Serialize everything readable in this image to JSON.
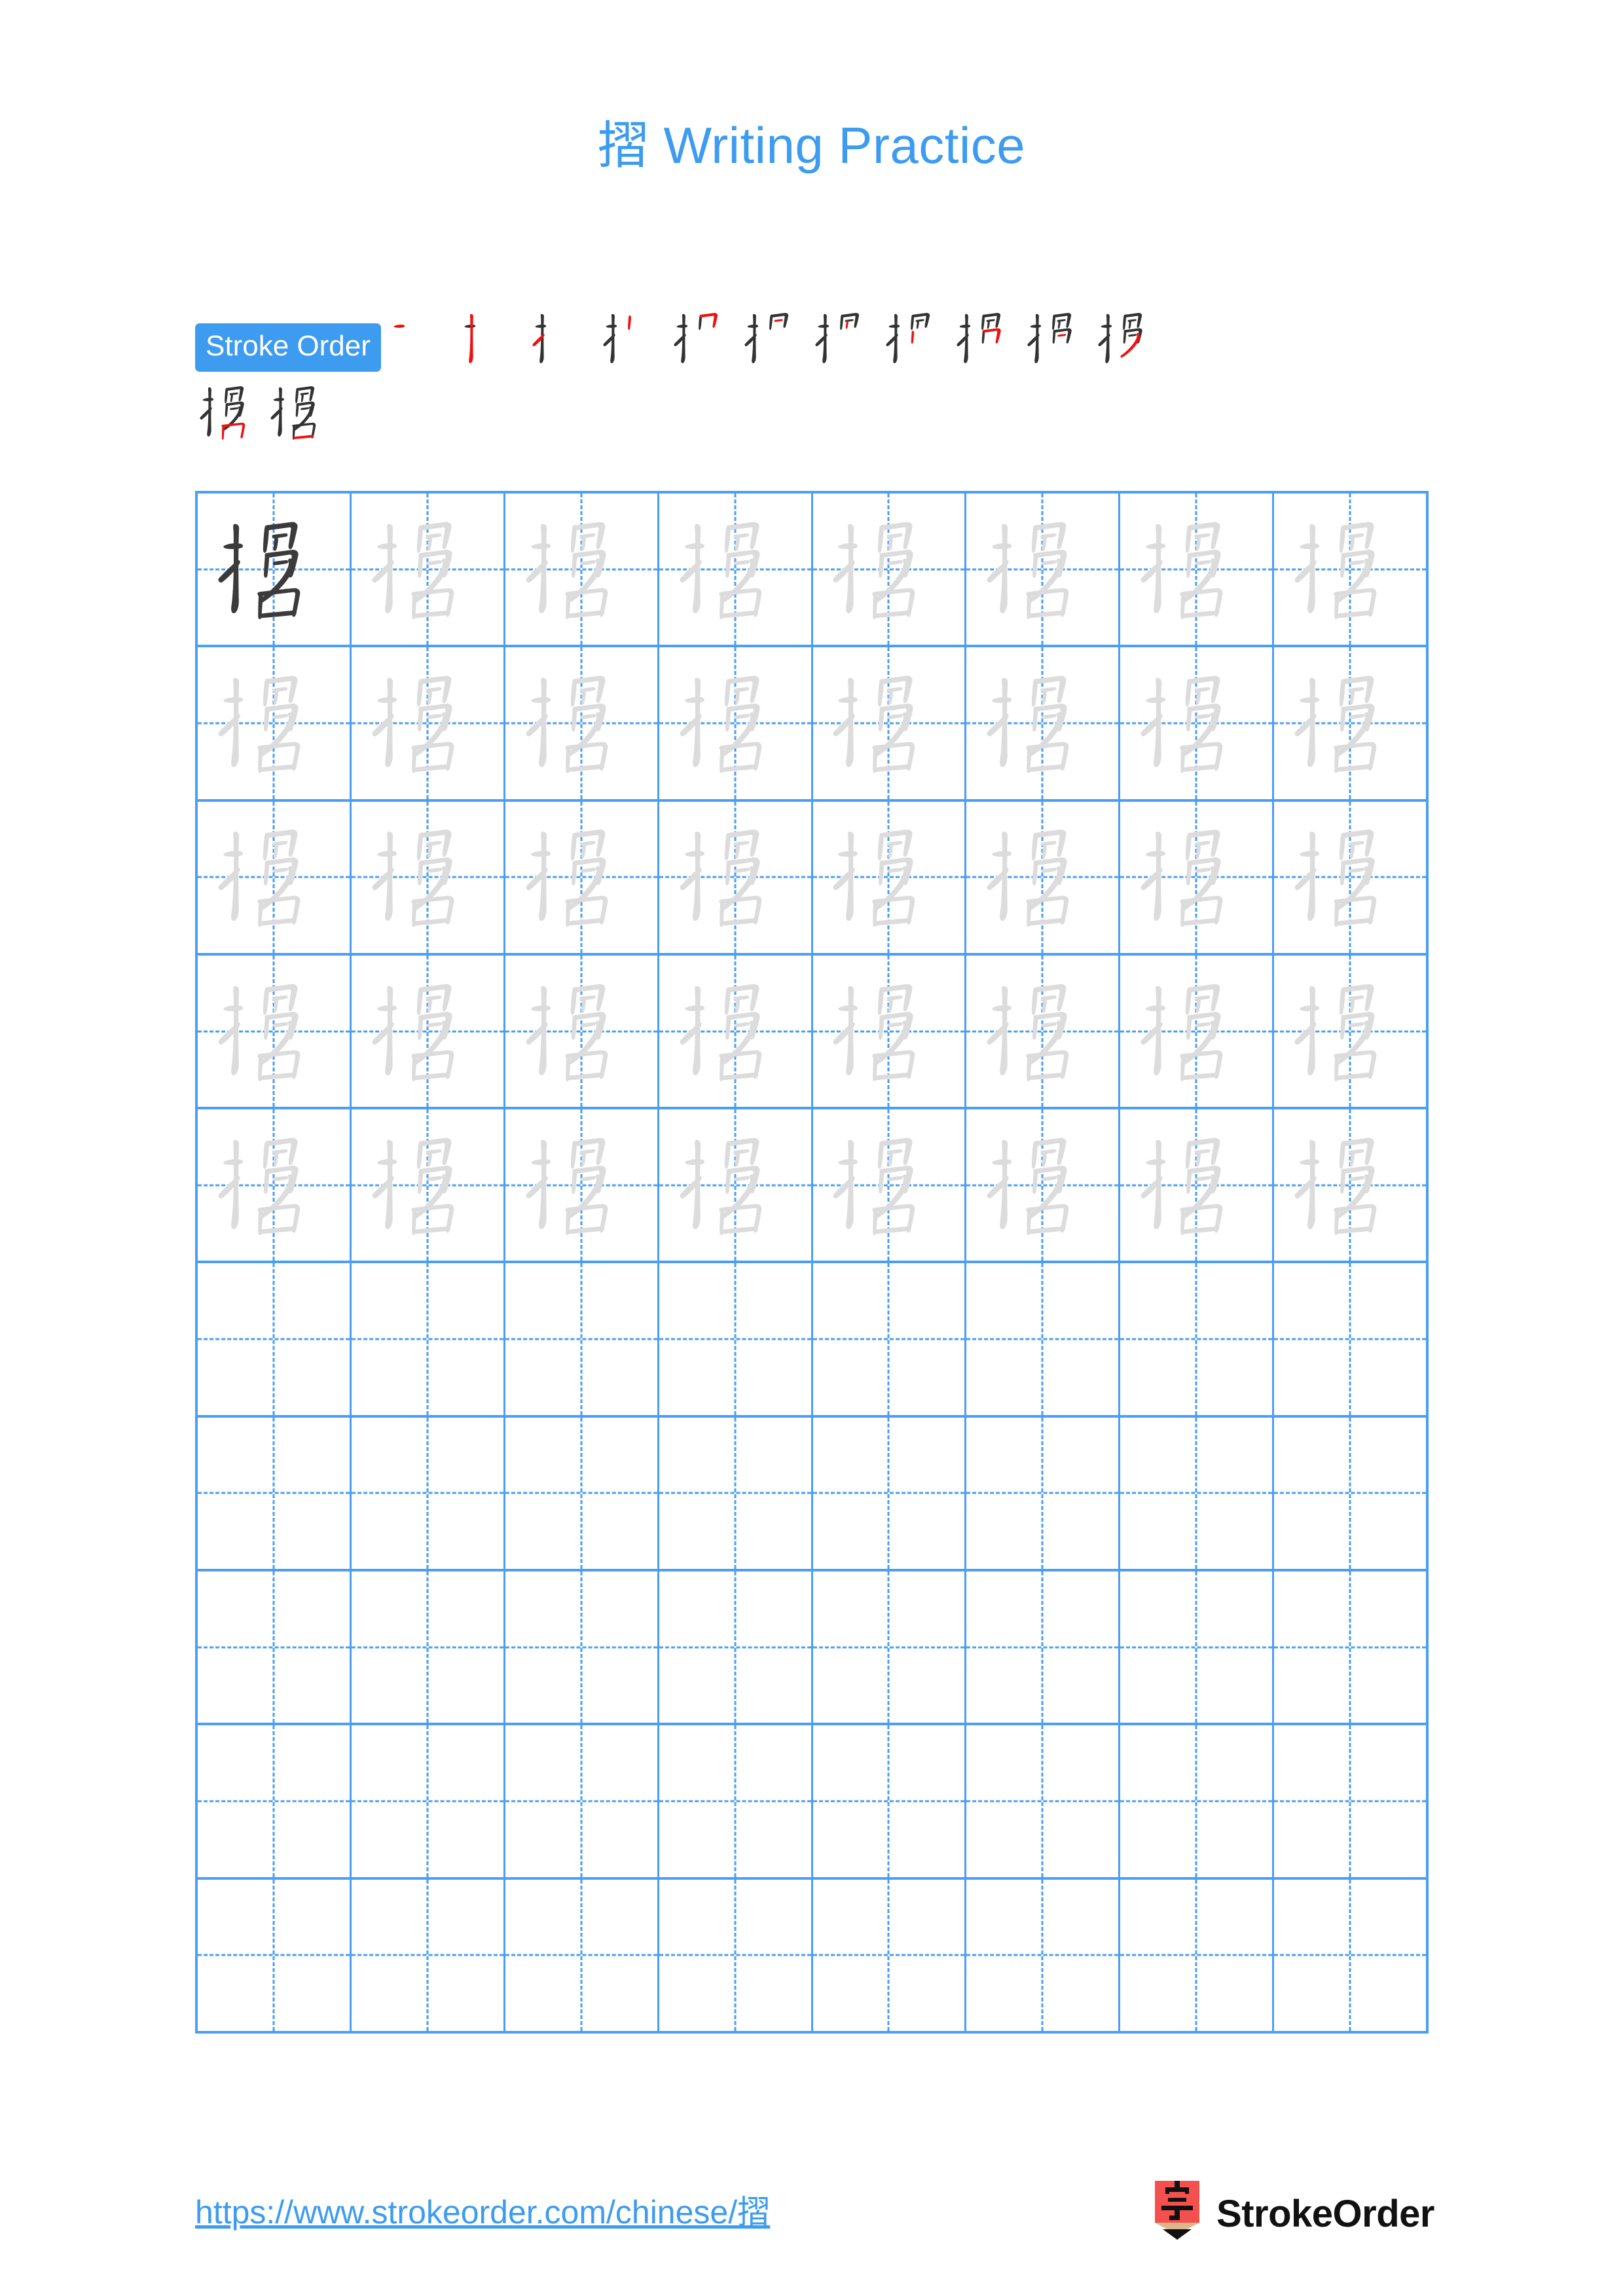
{
  "character": "摺",
  "title": {
    "character": "摺",
    "suffix": " Writing Practice",
    "full": "摺 Writing Practice",
    "color": "#3d9bf0"
  },
  "stroke_order": {
    "badge_label": "Stroke Order",
    "badge_bg": "#3d9bf0",
    "badge_text_color": "#ffffff",
    "total_strokes": 13,
    "new_stroke_color": "#ee1111",
    "base_stroke_color": "#333333",
    "steps": [
      {
        "index": 1,
        "strokes_shown": 1,
        "new_stroke": 1
      },
      {
        "index": 2,
        "strokes_shown": 2,
        "new_stroke": 2
      },
      {
        "index": 3,
        "strokes_shown": 3,
        "new_stroke": 3
      },
      {
        "index": 4,
        "strokes_shown": 4,
        "new_stroke": 4
      },
      {
        "index": 5,
        "strokes_shown": 5,
        "new_stroke": 5
      },
      {
        "index": 6,
        "strokes_shown": 6,
        "new_stroke": 6
      },
      {
        "index": 7,
        "strokes_shown": 7,
        "new_stroke": 7
      },
      {
        "index": 8,
        "strokes_shown": 8,
        "new_stroke": 8
      },
      {
        "index": 9,
        "strokes_shown": 9,
        "new_stroke": 9
      },
      {
        "index": 10,
        "strokes_shown": 10,
        "new_stroke": 10
      },
      {
        "index": 11,
        "strokes_shown": 11,
        "new_stroke": 11
      },
      {
        "index": 12,
        "strokes_shown": 12,
        "new_stroke": 12
      },
      {
        "index": 13,
        "strokes_shown": 13,
        "new_stroke": 13
      }
    ],
    "row_breaks": [
      11
    ]
  },
  "practice_grid": {
    "columns": 8,
    "rows": 10,
    "filled_rows": 5,
    "empty_rows": 5,
    "border_color": "#4a9ef5",
    "guide_color": "#4a9ef5",
    "model_char_color": "#3b3b3b",
    "trace_char_color": "#dcdcdc",
    "model_cell": {
      "row": 1,
      "column": 1,
      "character": "摺"
    },
    "trace_character": "摺"
  },
  "footer": {
    "url": "https://www.strokeorder.com/chinese/摺",
    "url_color": "#3d9bf0",
    "brand_name": "StrokeOrder",
    "logo_character": "字",
    "logo_body_color": "#f4514e",
    "logo_wood_color": "#dcb68c",
    "logo_tip_color": "#111111"
  }
}
